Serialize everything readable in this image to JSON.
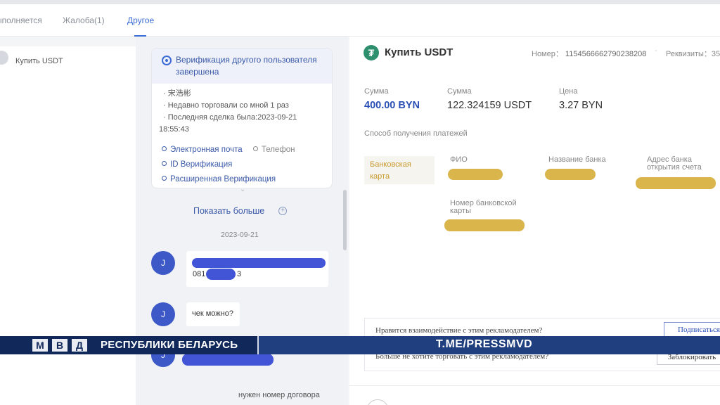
{
  "tabs": [
    {
      "label": "Выполняется"
    },
    {
      "label": "Жалоба(1)"
    },
    {
      "label": "Другое"
    }
  ],
  "sidebar": {
    "item_label": "Купить USDT"
  },
  "chat": {
    "verification": {
      "title": "Верификация другого пользователя завершена",
      "lines": [
        "· 宋浩彬",
        "· Недавно торговали со мной 1 раз",
        "· Последняя сделка была:2023-09-21",
        "18:55:43"
      ],
      "links": {
        "email": "Электронная почта",
        "phone": "Телефон",
        "id": "ID Верификация",
        "extended": "Расширенная Верификация"
      }
    },
    "show_more": "Показать больше",
    "date": "2023-09-21",
    "messages": [
      {
        "avatar": "J",
        "partial_text_left": "081",
        "partial_text_right": "3"
      },
      {
        "avatar": "J",
        "text": "чек можно?"
      },
      {
        "avatar": "J"
      }
    ],
    "last_message": "нужен номер договора"
  },
  "detail": {
    "title": "Купить USDT",
    "order_label": "Номер：",
    "order_number": "1154566662790238208",
    "requisites_label": "Реквизиты：35",
    "fields": [
      {
        "label": "Сумма",
        "value": "400.00 BYN"
      },
      {
        "label": "Сумма",
        "value": "122.324159 USDT"
      },
      {
        "label": "Цена",
        "value": "3.27 BYN"
      }
    ],
    "payment_method_label": "Способ получения платежей",
    "payment_method": "Банковская карта",
    "payment_fields": {
      "name": "ФИО",
      "bank": "Название банка",
      "bank_address": "Адрес банка открытия счета",
      "card_number": "Номер банковской карты"
    },
    "feedback": {
      "q1": "Нравится взаимодействие с этим рекламодателем?",
      "subscribe": "Подписаться",
      "q2": "Больше не хотите торговать с этим рекламодателем?",
      "block": "Заблокировать"
    }
  },
  "banner": {
    "letters": [
      "М",
      "В",
      "Д"
    ],
    "text": "РЕСПУБЛИКИ БЕЛАРУСЬ",
    "channel": "T.ME/PRESSMVD"
  },
  "colors": {
    "accent": "#3b6bd6",
    "avatar": "#3c59c7",
    "tether": "#2e8f6f",
    "banner": "#1f3f7e"
  }
}
